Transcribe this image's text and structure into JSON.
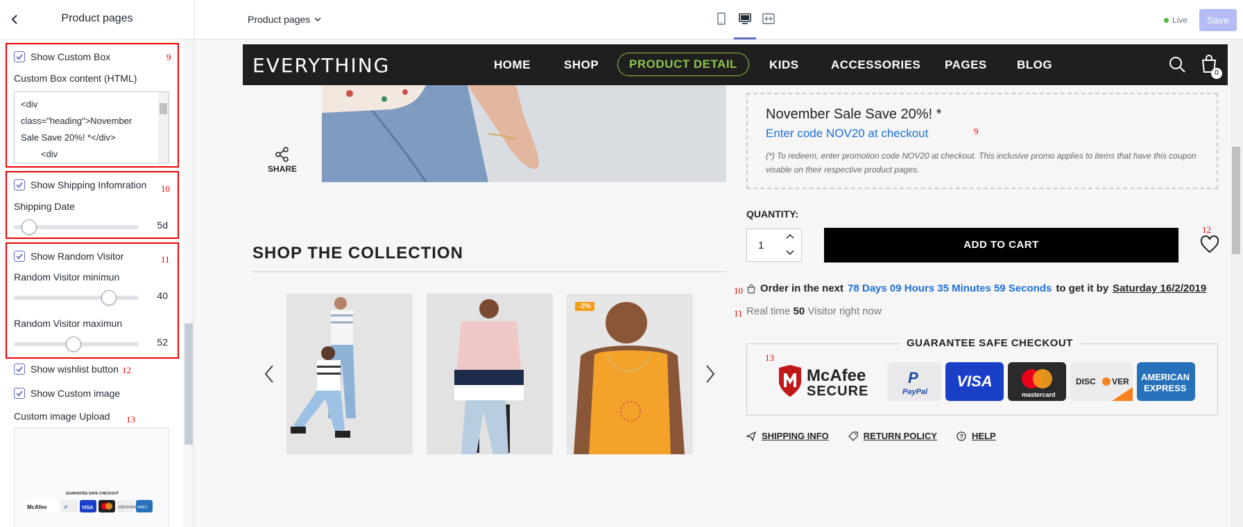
{
  "topbar": {
    "panel_title": "Product pages",
    "page_select": "Product pages",
    "live_label": "Live",
    "save_label": "Save"
  },
  "sidebar": {
    "custom_box": {
      "label": "Show Custom Box",
      "checked": true,
      "anno": "9",
      "content_label": "Custom Box content (HTML)",
      "content_value": "<div\nclass=\"heading\">November\nSale Save 20%! *</div>\n        <div"
    },
    "shipping": {
      "label": "Show Shipping Infomration",
      "checked": true,
      "anno": "10",
      "date_label": "Shipping Date",
      "date_value": "5d",
      "date_fraction": 0.12
    },
    "random_visitor": {
      "label": "Show Random Visitor",
      "checked": true,
      "anno": "11",
      "min_label": "Random Visitor minimun",
      "min_value": "40",
      "min_fraction": 0.76,
      "max_label": "Random Visitor maximun",
      "max_value": "52",
      "max_fraction": 0.48
    },
    "wishlist": {
      "label": "Show wishlist button",
      "checked": true,
      "anno": "12"
    },
    "custom_image": {
      "label": "Show Custom image",
      "checked": true
    },
    "image_upload": {
      "label": "Custom image Upload",
      "anno": "13",
      "thumb_title": "GUARANTEE SAFE CHECKOUT"
    }
  },
  "store": {
    "logo": "EVERYTHING",
    "nav": [
      "HOME",
      "SHOP",
      "PRODUCT DETAIL",
      "KIDS",
      "ACCESSORIES",
      "PAGES",
      "BLOG"
    ],
    "cart_count": "0",
    "share_label": "SHARE",
    "collection_title": "SHOP THE COLLECTION",
    "sale_badge": "-2%",
    "promo": {
      "title": "November Sale Save 20%! *",
      "code_text": "Enter code NOV20 at checkout",
      "anno": "9",
      "note": "(*) To redeem, enter promotion code NOV20 at checkout. This inclusive promo applies to items that have this coupon visable on their respective product pages."
    },
    "quantity_label": "QUANTITY:",
    "quantity_value": "1",
    "add_to_cart": "ADD TO CART",
    "wishlist_anno": "12",
    "order": {
      "anno": "10",
      "prefix": "Order in the next",
      "countdown": "78 Days 09 Hours 35 Minutes 59 Seconds",
      "middle": "to get it by",
      "date": "Saturday 16/2/2019"
    },
    "visitor": {
      "anno": "11",
      "prefix": "Real time",
      "count": "50",
      "suffix": "Visitor right now"
    },
    "guarantee": {
      "anno": "13",
      "title": "GUARANTEE SAFE CHECKOUT",
      "badges": [
        "McAfee SECURE",
        "PayPal",
        "VISA",
        "mastercard",
        "DISCOVER",
        "AMERICAN EXPRESS"
      ]
    },
    "footer_links": [
      "SHIPPING INFO",
      "RETURN POLICY",
      "HELP"
    ]
  },
  "colors": {
    "accent": "#5c6ac4",
    "annotation": "#ee0000",
    "link_blue": "#1e6fd9",
    "nav_active": "#8bc34a"
  }
}
